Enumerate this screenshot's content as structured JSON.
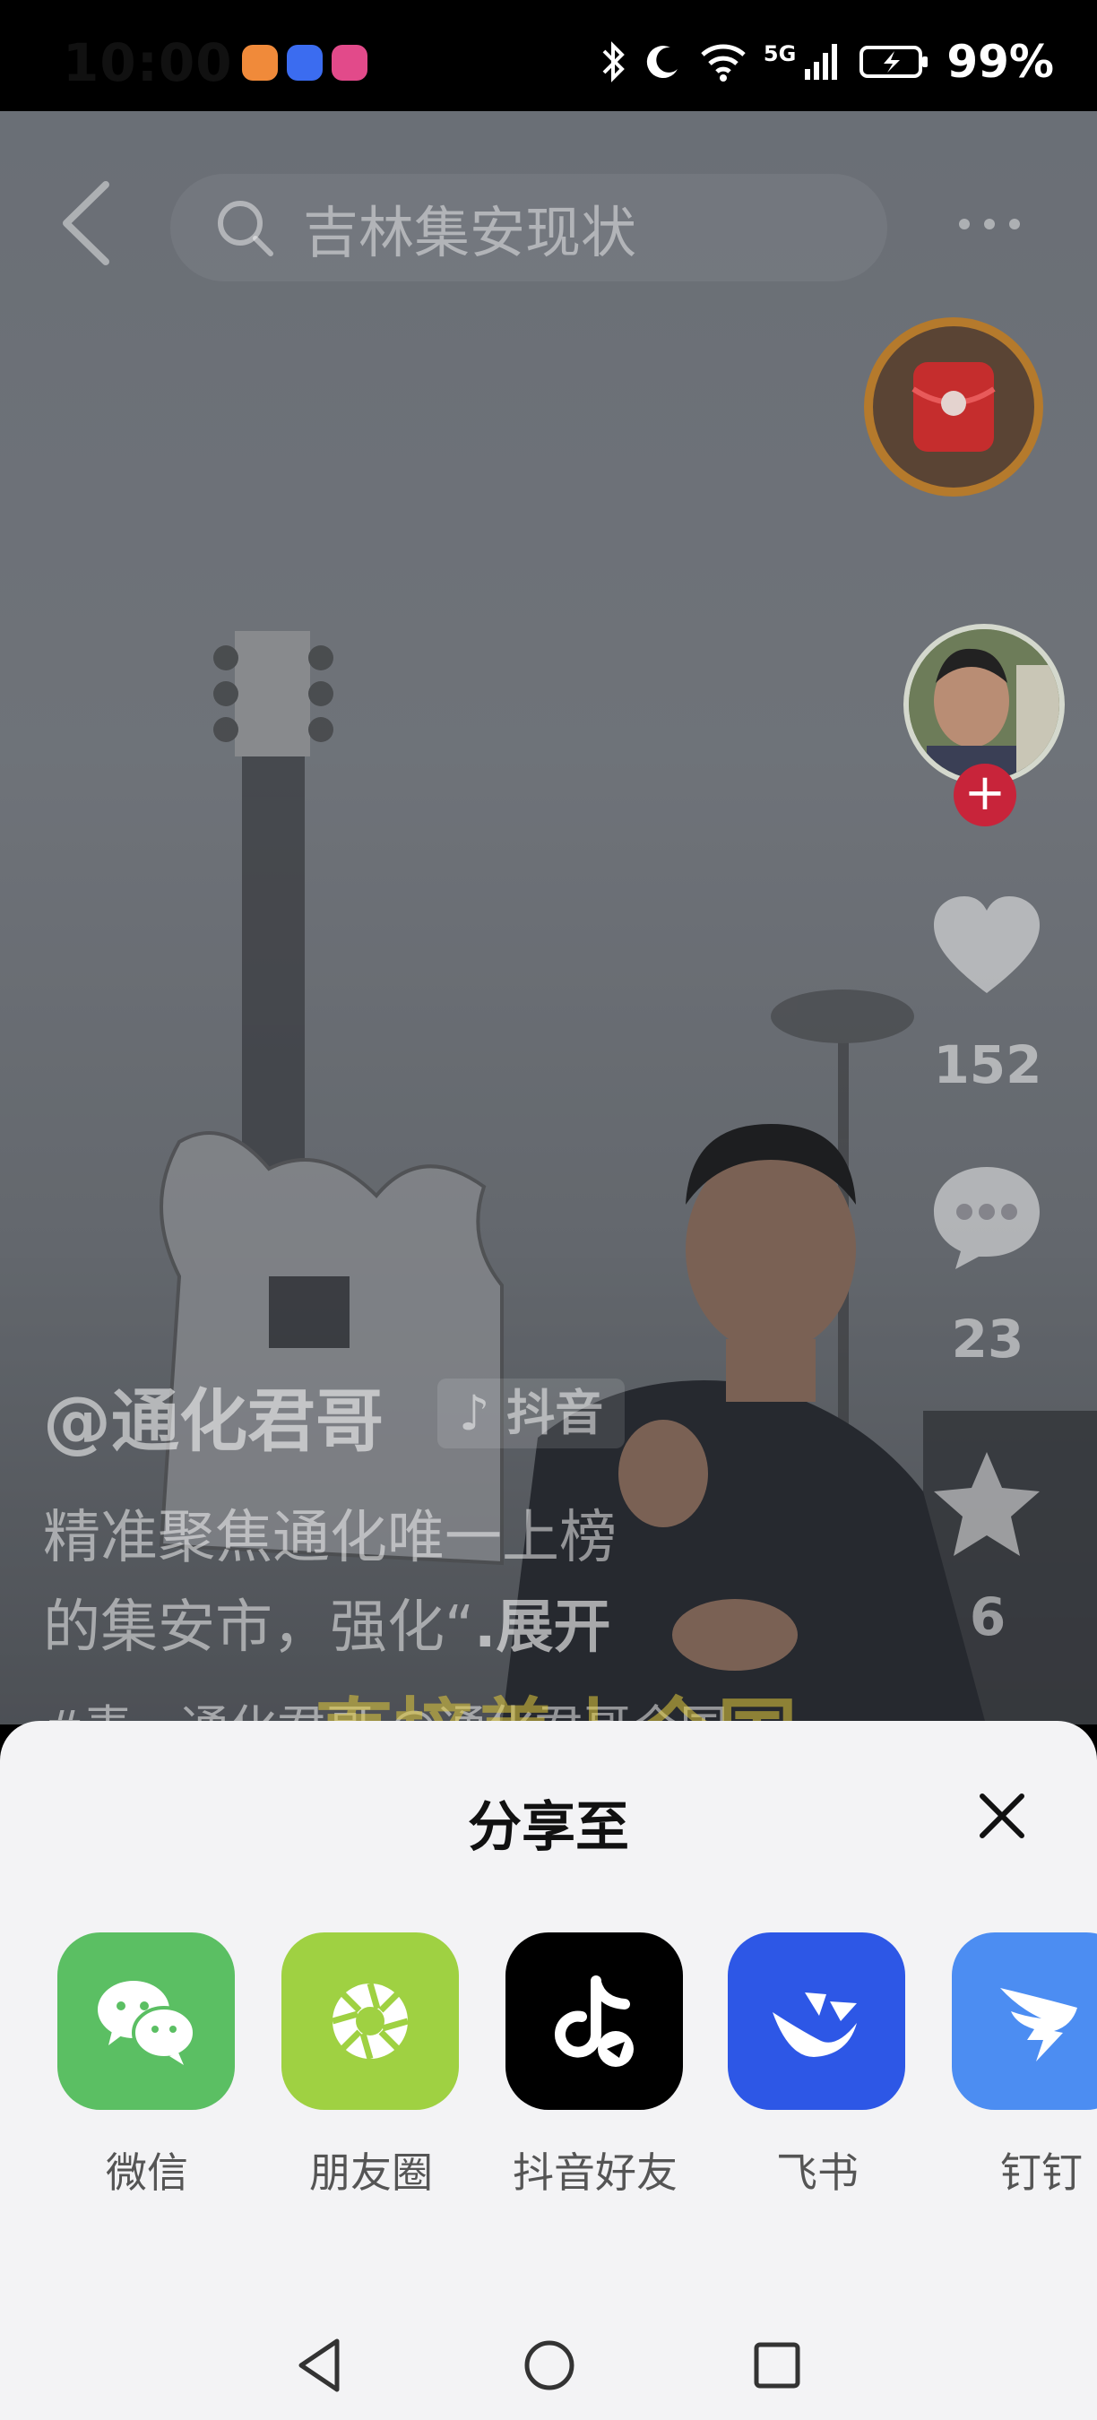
{
  "status_bar": {
    "time": "10:00",
    "network": "5G",
    "battery": "99%",
    "app_icon_colors": [
      "#f08a3a",
      "#3b6cf0",
      "#e24a8a"
    ]
  },
  "top_bar": {
    "search_text": "吉林集安现状"
  },
  "right_rail": {
    "like_count": "152",
    "comment_count": "23",
    "favorite_count": "6"
  },
  "caption": {
    "author": "@通化君哥",
    "platform_tag": "抖音",
    "desc_line1": "精准聚焦通化唯一上榜",
    "desc_line2": "的集安市，强化“",
    "desc_line2_more": ".展开",
    "desc_line3": "#麦…通化君哥 @通化君哥全国",
    "overlay_subtitle": "直接盖上全国"
  },
  "share_sheet": {
    "title": "分享至",
    "targets": [
      {
        "label": "微信",
        "color": "#5bbf63",
        "icon": "wechat-icon"
      },
      {
        "label": "朋友圈",
        "color": "#9fd142",
        "icon": "moments-icon"
      },
      {
        "label": "抖音好友",
        "color": "#000000",
        "icon": "douyin-icon"
      },
      {
        "label": "飞书",
        "color": "#2d57e6",
        "icon": "feishu-icon"
      },
      {
        "label": "钉钉",
        "color": "#4c8df2",
        "icon": "dingtalk-icon"
      }
    ]
  }
}
